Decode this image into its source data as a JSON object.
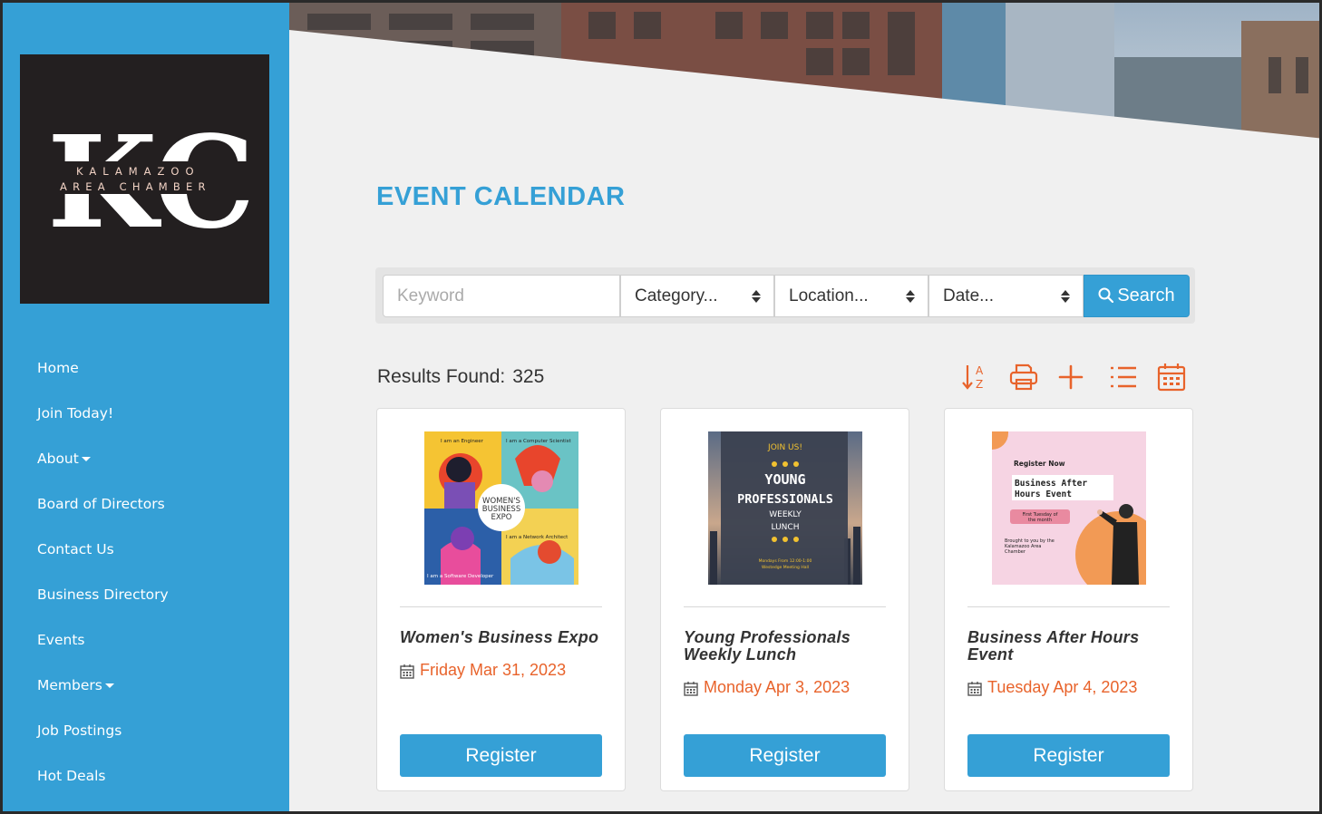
{
  "logo": {
    "letters": "KC",
    "line1": "KALAMAZOO",
    "line2": "AREA CHAMBER"
  },
  "nav": [
    {
      "label": "Home",
      "dropdown": false
    },
    {
      "label": "Join Today!",
      "dropdown": false
    },
    {
      "label": "About",
      "dropdown": true
    },
    {
      "label": "Board of Directors",
      "dropdown": false
    },
    {
      "label": "Contact Us",
      "dropdown": false
    },
    {
      "label": "Business Directory",
      "dropdown": false
    },
    {
      "label": "Events",
      "dropdown": false
    },
    {
      "label": "Members",
      "dropdown": true
    },
    {
      "label": "Job Postings",
      "dropdown": false
    },
    {
      "label": "Hot Deals",
      "dropdown": false
    }
  ],
  "page": {
    "title": "EVENT CALENDAR"
  },
  "search": {
    "keyword_placeholder": "Keyword",
    "category": "Category...",
    "location": "Location...",
    "date": "Date...",
    "button": "Search"
  },
  "results": {
    "label": "Results Found:",
    "count": "325"
  },
  "toolbar_icons": [
    "sort-az-icon",
    "print-icon",
    "add-icon",
    "list-view-icon",
    "calendar-view-icon"
  ],
  "colors": {
    "primary": "#35a0d6",
    "accent": "#e8632b",
    "sidebar": "#35a0d6",
    "logo_bg": "#231f20"
  },
  "events": [
    {
      "name": "Women's Business Expo",
      "date": "Friday Mar 31, 2023",
      "button": "Register",
      "image": {
        "panel1": "I am an Engineer",
        "panel2": "I am a Computer Scientist",
        "panel3": "I am a Software Developer",
        "panel4": "I am a Network Architect",
        "badge1": "WOMEN'S",
        "badge2": "BUSINESS",
        "badge3": "EXPO"
      }
    },
    {
      "name": "Young Professionals Weekly Lunch",
      "date": "Monday Apr 3, 2023",
      "button": "Register",
      "image": {
        "join": "JOIN US!",
        "line1": "YOUNG",
        "line2": "PROFESSIONALS",
        "line3": "WEEKLY",
        "line4": "LUNCH",
        "foot1": "Mondays From 12:00-1:00",
        "foot2": "Westedge Meeting Hall"
      }
    },
    {
      "name": "Business After Hours Event",
      "date": "Tuesday Apr 4, 2023",
      "button": "Register",
      "image": {
        "register": "Register Now",
        "title1": "Business After",
        "title2": "Hours Event",
        "pill1": "First Tuesday of",
        "pill2": "the month",
        "foot1": "Brought to you by the",
        "foot2": "Kalamazoo Area",
        "foot3": "Chamber"
      }
    }
  ]
}
